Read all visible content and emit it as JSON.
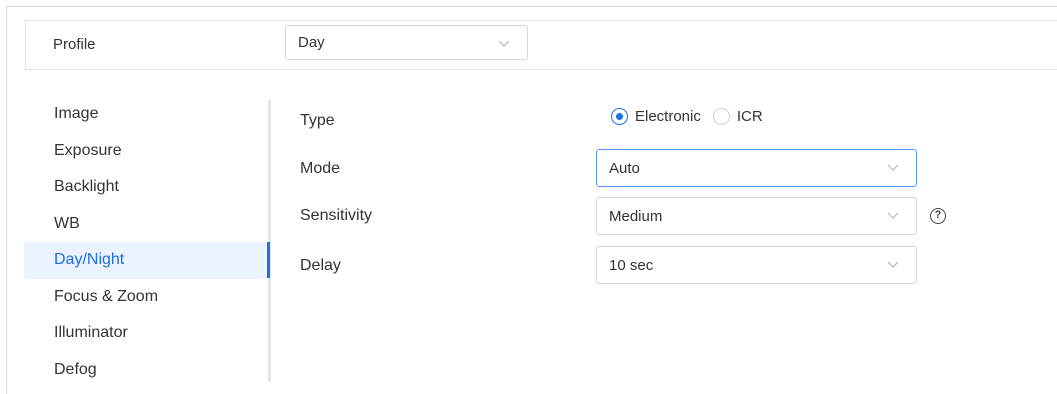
{
  "profile": {
    "label": "Profile",
    "selected": "Day"
  },
  "menu": {
    "items": [
      {
        "label": "Image",
        "active": false
      },
      {
        "label": "Exposure",
        "active": false
      },
      {
        "label": "Backlight",
        "active": false
      },
      {
        "label": "WB",
        "active": false
      },
      {
        "label": "Day/Night",
        "active": true
      },
      {
        "label": "Focus & Zoom",
        "active": false
      },
      {
        "label": "Illuminator",
        "active": false
      },
      {
        "label": "Defog",
        "active": false
      }
    ]
  },
  "form": {
    "type": {
      "label": "Type",
      "options": [
        "Electronic",
        "ICR"
      ],
      "selected": "Electronic"
    },
    "mode": {
      "label": "Mode",
      "value": "Auto"
    },
    "sensitivity": {
      "label": "Sensitivity",
      "value": "Medium",
      "help_icon": "question-circle-icon"
    },
    "delay": {
      "label": "Delay",
      "value": "10 sec"
    }
  },
  "colors": {
    "accent": "#1a73e8",
    "active_bg": "#eaf3ff",
    "active_text": "#1d6fe0"
  }
}
